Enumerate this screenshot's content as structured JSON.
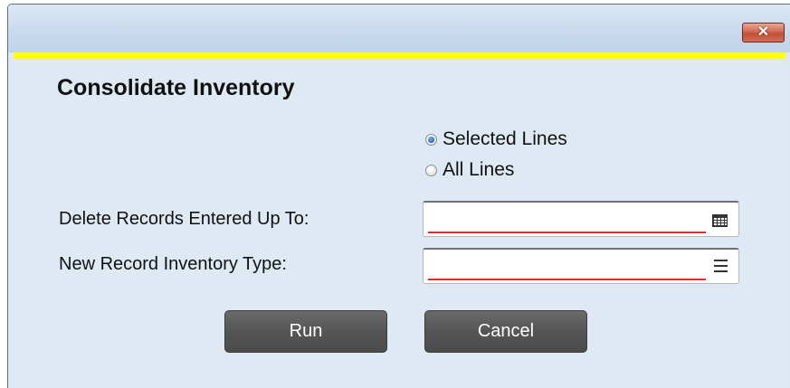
{
  "window": {
    "close_glyph": "✕"
  },
  "dialog": {
    "title": "Consolidate Inventory",
    "accent_color": "#ffff00",
    "scope_options": [
      {
        "label": "Selected Lines",
        "selected": true
      },
      {
        "label": "All Lines",
        "selected": false
      }
    ],
    "fields": {
      "delete_records": {
        "label": "Delete Records Entered Up To:",
        "value": "",
        "icon": "calendar-icon"
      },
      "inventory_type": {
        "label": "New Record Inventory Type:",
        "value": "",
        "icon": "menu-icon"
      }
    },
    "buttons": {
      "run": "Run",
      "cancel": "Cancel"
    }
  }
}
